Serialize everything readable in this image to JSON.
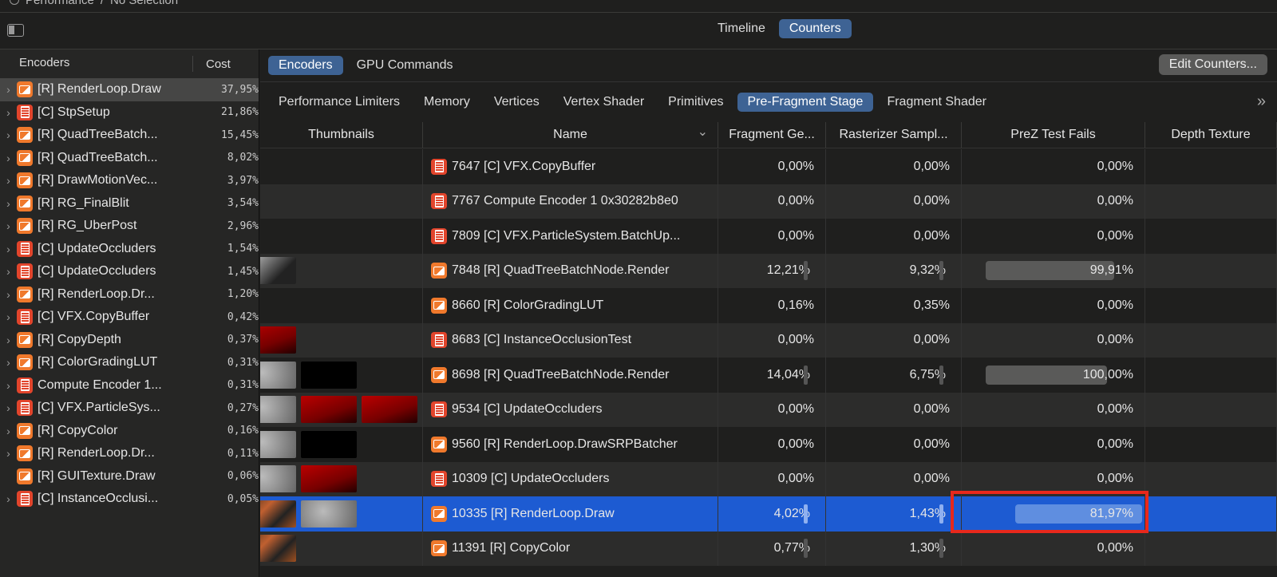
{
  "breadcrumb": [
    "Performance",
    "No Selection"
  ],
  "view_toggle": {
    "items": [
      "Timeline",
      "Counters"
    ],
    "selected": "Counters"
  },
  "sidebar": {
    "headers": {
      "name": "Encoders",
      "cost": "Cost"
    },
    "items": [
      {
        "type": "r",
        "name": "[R] RenderLoop.Draw",
        "cost": "37,95%",
        "selected": true,
        "chev": true
      },
      {
        "type": "c",
        "name": "[C] StpSetup",
        "cost": "21,86%",
        "chev": true
      },
      {
        "type": "r",
        "name": "[R] QuadTreeBatch...",
        "cost": "15,45%",
        "chev": true
      },
      {
        "type": "r",
        "name": "[R] QuadTreeBatch...",
        "cost": "8,02%",
        "chev": true
      },
      {
        "type": "r",
        "name": "[R] DrawMotionVec...",
        "cost": "3,97%",
        "chev": true
      },
      {
        "type": "r",
        "name": "[R] RG_FinalBlit",
        "cost": "3,54%",
        "chev": true
      },
      {
        "type": "r",
        "name": "[R] RG_UberPost",
        "cost": "2,96%",
        "chev": true
      },
      {
        "type": "c",
        "name": "[C] UpdateOccluders",
        "cost": "1,54%",
        "chev": true
      },
      {
        "type": "c",
        "name": "[C] UpdateOccluders",
        "cost": "1,45%",
        "chev": true
      },
      {
        "type": "r",
        "name": "[R] RenderLoop.Dr...",
        "cost": "1,20%",
        "chev": true
      },
      {
        "type": "c",
        "name": "[C] VFX.CopyBuffer",
        "cost": "0,42%",
        "chev": true
      },
      {
        "type": "r",
        "name": "[R] CopyDepth",
        "cost": "0,37%",
        "chev": true
      },
      {
        "type": "r",
        "name": "[R] ColorGradingLUT",
        "cost": "0,31%",
        "chev": true
      },
      {
        "type": "c",
        "name": "Compute Encoder 1...",
        "cost": "0,31%",
        "chev": true
      },
      {
        "type": "c",
        "name": "[C] VFX.ParticleSys...",
        "cost": "0,27%",
        "chev": true
      },
      {
        "type": "r",
        "name": "[R] CopyColor",
        "cost": "0,16%",
        "chev": true
      },
      {
        "type": "r",
        "name": "[R] RenderLoop.Dr...",
        "cost": "0,11%",
        "chev": true
      },
      {
        "type": "r",
        "name": "[R] GUITexture.Draw",
        "cost": "0,06%",
        "chev": false
      },
      {
        "type": "c",
        "name": "[C] InstanceOcclusi...",
        "cost": "0,05%",
        "chev": true
      }
    ]
  },
  "main": {
    "tabs": [
      "Encoders",
      "GPU Commands"
    ],
    "selected_tab": "Encoders",
    "edit_button": "Edit Counters...",
    "subtabs": [
      "Performance Limiters",
      "Memory",
      "Vertices",
      "Vertex Shader",
      "Primitives",
      "Pre-Fragment Stage",
      "Fragment Shader"
    ],
    "selected_subtab": "Pre-Fragment Stage",
    "more": "»",
    "columns": [
      "Thumbnails",
      "Name",
      "Fragment Ge...",
      "Rasterizer Sampl...",
      "PreZ Test Fails",
      "Depth Texture"
    ],
    "sort_icon": "⌄",
    "rows": [
      {
        "type": "c",
        "name": "7647 [C] VFX.CopyBuffer",
        "frag": "0,00%",
        "rast": "0,00%",
        "prez": "0,00%",
        "fv": 0,
        "rv": 0,
        "pv": 0,
        "thumbs": []
      },
      {
        "type": "c",
        "name": "7767 Compute Encoder 1 0x30282b8e0",
        "frag": "0,00%",
        "rast": "0,00%",
        "prez": "0,00%",
        "fv": 0,
        "rv": 0,
        "pv": 0,
        "thumbs": []
      },
      {
        "type": "c",
        "name": "7809 [C] VFX.ParticleSystem.BatchUp...",
        "frag": "0,00%",
        "rast": "0,00%",
        "prez": "0,00%",
        "fv": 0,
        "rv": 0,
        "pv": 0,
        "thumbs": []
      },
      {
        "type": "r",
        "name": "7848 [R] QuadTreeBatchNode.Render",
        "frag": "12,21%",
        "rast": "9,32%",
        "prez": "99,91%",
        "fv": 12.21,
        "rv": 9.32,
        "pv": 99.91,
        "thumbs": [
          "bw"
        ]
      },
      {
        "type": "r",
        "name": "8660 [R] ColorGradingLUT",
        "frag": "0,16%",
        "rast": "0,35%",
        "prez": "0,00%",
        "fv": 0,
        "rv": 0,
        "pv": 0,
        "thumbs": []
      },
      {
        "type": "c",
        "name": "8683 [C] InstanceOcclusionTest",
        "frag": "0,00%",
        "rast": "0,00%",
        "prez": "0,00%",
        "fv": 0,
        "rv": 0,
        "pv": 0,
        "thumbs": [
          "red"
        ]
      },
      {
        "type": "r",
        "name": "8698 [R] QuadTreeBatchNode.Render",
        "frag": "14,04%",
        "rast": "6,75%",
        "prez": "100,00%",
        "fv": 14.04,
        "rv": 6.75,
        "pv": 100,
        "thumbs": [
          "gray",
          "black"
        ]
      },
      {
        "type": "c",
        "name": "9534 [C] UpdateOccluders",
        "frag": "0,00%",
        "rast": "0,00%",
        "prez": "0,00%",
        "fv": 0,
        "rv": 0,
        "pv": 0,
        "thumbs": [
          "gray",
          "red",
          "red"
        ]
      },
      {
        "type": "r",
        "name": "9560 [R] RenderLoop.DrawSRPBatcher",
        "frag": "0,00%",
        "rast": "0,00%",
        "prez": "0,00%",
        "fv": 0,
        "rv": 0,
        "pv": 0,
        "thumbs": [
          "gray",
          "black"
        ]
      },
      {
        "type": "c",
        "name": "10309 [C] UpdateOccluders",
        "frag": "0,00%",
        "rast": "0,00%",
        "prez": "0,00%",
        "fv": 0,
        "rv": 0,
        "pv": 0,
        "thumbs": [
          "gray",
          "red"
        ]
      },
      {
        "type": "r",
        "name": "10335 [R] RenderLoop.Draw",
        "frag": "4,02%",
        "rast": "1,43%",
        "prez": "81,97%",
        "fv": 4.02,
        "rv": 1.43,
        "pv": 81.97,
        "thumbs": [
          "scene",
          "gray"
        ],
        "selected": true
      },
      {
        "type": "r",
        "name": "11391 [R] CopyColor",
        "frag": "0,77%",
        "rast": "1,30%",
        "prez": "0,00%",
        "fv": 0.77,
        "rv": 1.3,
        "pv": 0,
        "thumbs": [
          "scene"
        ]
      }
    ]
  },
  "colors": {
    "accent": "#3e6394",
    "selection": "#1d5bd2",
    "highlight": "#e8281c"
  }
}
